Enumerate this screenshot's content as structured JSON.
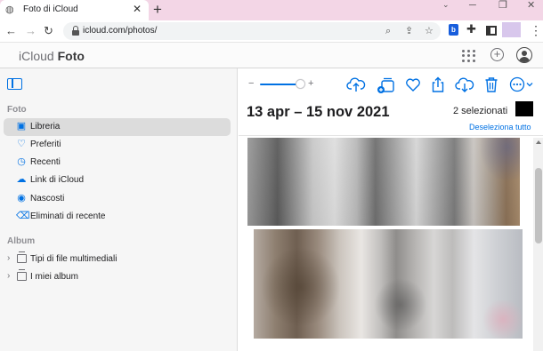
{
  "browser": {
    "tab_title": "Foto di iCloud",
    "tab_close": "✕",
    "new_tab": "+",
    "url": "icloud.com/photos/",
    "window_controls": {
      "minimize": "─",
      "restore": "❐",
      "close": "✕"
    },
    "profile_color": "#d8c7ec",
    "tabbar_color": "#f3d6e6"
  },
  "header": {
    "brand_light": "iCloud",
    "brand_bold": "Foto",
    "icons": [
      "apple-logo",
      "app-grid-icon",
      "plus-circle-icon",
      "account-icon"
    ]
  },
  "sidebar": {
    "section_foto": "Foto",
    "items": [
      {
        "label": "Libreria",
        "icon": "library-icon",
        "glyph": "▣",
        "active": true
      },
      {
        "label": "Preferiti",
        "icon": "heart-icon",
        "glyph": "♡",
        "active": false
      },
      {
        "label": "Recenti",
        "icon": "clock-icon",
        "glyph": "◷",
        "active": false
      },
      {
        "label": "Link di iCloud",
        "icon": "cloud-link-icon",
        "glyph": "☁",
        "active": false
      },
      {
        "label": "Nascosti",
        "icon": "eye-slash-icon",
        "glyph": "◉",
        "active": false
      },
      {
        "label": "Eliminati di recente",
        "icon": "trash-icon",
        "glyph": "🗑",
        "active": false
      }
    ],
    "section_album": "Album",
    "albums": [
      {
        "label": "Tipi di file multimediali",
        "icon": "folder-icon"
      },
      {
        "label": "I miei album",
        "icon": "folder-icon"
      }
    ]
  },
  "main": {
    "zoom_minus": "−",
    "zoom_plus": "+",
    "zoom_level": 0.82,
    "date_range": "13 apr – 15 nov 2021",
    "selected_count": "2 selezionati",
    "deselect_all": "Deseleziona tutto",
    "toolbar": [
      "upload-icon",
      "add-to-album-icon",
      "favorite-heart-icon",
      "share-icon",
      "download-icon",
      "delete-icon",
      "more-icon"
    ]
  },
  "colors": {
    "accent": "#0071e3",
    "sidebar_bg": "#f6f6f6",
    "active_item_bg": "#dcdcdc"
  }
}
